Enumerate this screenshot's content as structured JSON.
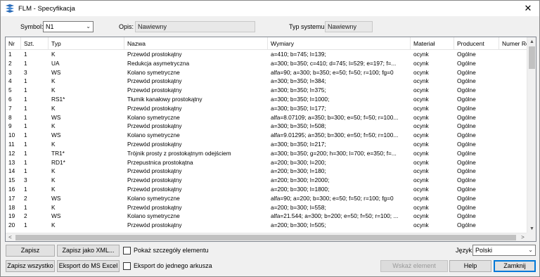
{
  "window": {
    "title": "FLM - Specyfikacja",
    "close_glyph": "✕"
  },
  "filters": {
    "symbol_label": "Symbol:",
    "symbol_value": "N1",
    "opis_label": "Opis:",
    "opis_value": "Nawiewny",
    "typ_systemu_label": "Typ systemu:",
    "typ_systemu_value": "Nawiewny"
  },
  "table": {
    "columns": [
      "Nr",
      "Szt.",
      "Typ",
      "Nazwa",
      "Wymiary",
      "Materiał",
      "Producent",
      "Numer Ref"
    ],
    "rows": [
      [
        "1",
        "1",
        "K",
        "Przewód prostokątny",
        "a=410; b=745; l=139;",
        "ocynk",
        "Ogólne"
      ],
      [
        "2",
        "1",
        "UA",
        "Redukcja asymetryczna",
        "a=300; b=350; c=410; d=745; l=529; e=197; f=...",
        "ocynk",
        "Ogólne"
      ],
      [
        "3",
        "3",
        "WS",
        "Kolano symetryczne",
        "alfa=90;  a=300;  b=350;  e=50;  f=50;  r=100;  fg=0",
        "ocynk",
        "Ogólne"
      ],
      [
        "4",
        "1",
        "K",
        "Przewód prostokątny",
        "a=300; b=350; l=384;",
        "ocynk",
        "Ogólne"
      ],
      [
        "5",
        "1",
        "K",
        "Przewód prostokątny",
        "a=300; b=350; l=375;",
        "ocynk",
        "Ogólne"
      ],
      [
        "6",
        "1",
        "RS1*",
        "Tłumik kanałowy prostokątny",
        "a=300; b=350; l=1000;",
        "ocynk",
        "Ogólne"
      ],
      [
        "7",
        "1",
        "K",
        "Przewód prostokątny",
        "a=300; b=350; l=177;",
        "ocynk",
        "Ogólne"
      ],
      [
        "8",
        "1",
        "WS",
        "Kolano symetryczne",
        "alfa=8.07109;  a=350;  b=300;  e=50;  f=50;  r=100...",
        "ocynk",
        "Ogólne"
      ],
      [
        "9",
        "1",
        "K",
        "Przewód prostokątny",
        "a=300; b=350; l=508;",
        "ocynk",
        "Ogólne"
      ],
      [
        "10",
        "1",
        "WS",
        "Kolano symetryczne",
        "alfa=9.01295;  a=350;  b=300;  e=50;  f=50;  r=100...",
        "ocynk",
        "Ogólne"
      ],
      [
        "11",
        "1",
        "K",
        "Przewód prostokątny",
        "a=300; b=350; l=217;",
        "ocynk",
        "Ogólne"
      ],
      [
        "12",
        "1",
        "TR1*",
        "Trójnik prosty z prostokątnym odejściem",
        "a=300;  b=350;  g=200;  h=300;  l=700;  e=350;  f=...",
        "ocynk",
        "Ogólne"
      ],
      [
        "13",
        "1",
        "RD1*",
        "Przepustnica prostokątna",
        "a=200; b=300; l=200;",
        "ocynk",
        "Ogólne"
      ],
      [
        "14",
        "1",
        "K",
        "Przewód prostokątny",
        "a=200; b=300; l=180;",
        "ocynk",
        "Ogólne"
      ],
      [
        "15",
        "3",
        "K",
        "Przewód prostokątny",
        "a=200; b=300; l=2000;",
        "ocynk",
        "Ogólne"
      ],
      [
        "16",
        "1",
        "K",
        "Przewód prostokątny",
        "a=200; b=300; l=1800;",
        "ocynk",
        "Ogólne"
      ],
      [
        "17",
        "2",
        "WS",
        "Kolano symetryczne",
        "alfa=90;  a=200;  b=300;  e=50;  f=50;  r=100;  fg=0",
        "ocynk",
        "Ogólne"
      ],
      [
        "18",
        "1",
        "K",
        "Przewód prostokątny",
        "a=200; b=300; l=558;",
        "ocynk",
        "Ogólne"
      ],
      [
        "19",
        "2",
        "WS",
        "Kolano symetryczne",
        "alfa=21.544;  a=300;  b=200;  e=50;  f=50;  r=100; ...",
        "ocynk",
        "Ogólne"
      ],
      [
        "20",
        "1",
        "K",
        "Przewód prostokątny",
        "a=200; b=300; l=505;",
        "ocynk",
        "Ogólne"
      ]
    ]
  },
  "buttons": {
    "zapisz": "Zapisz",
    "zapisz_xml": "Zapisz jako XML...",
    "zapisz_wszystko": "Zapisz wszystko",
    "eksport_excel": "Eksport do MS Excel",
    "wskaz_element": "Wskaż element",
    "help": "Help",
    "zamknij": "Zamknij"
  },
  "checkboxes": {
    "pokaz_szczegoly": "Pokaż szczegóły elementu",
    "eksport_arkusz": "Eksport do jednego arkusza"
  },
  "language": {
    "label": "Język:",
    "value": "Polski"
  },
  "scroll": {
    "up": "▲",
    "down": "▼",
    "left": "<",
    "right": ">"
  }
}
